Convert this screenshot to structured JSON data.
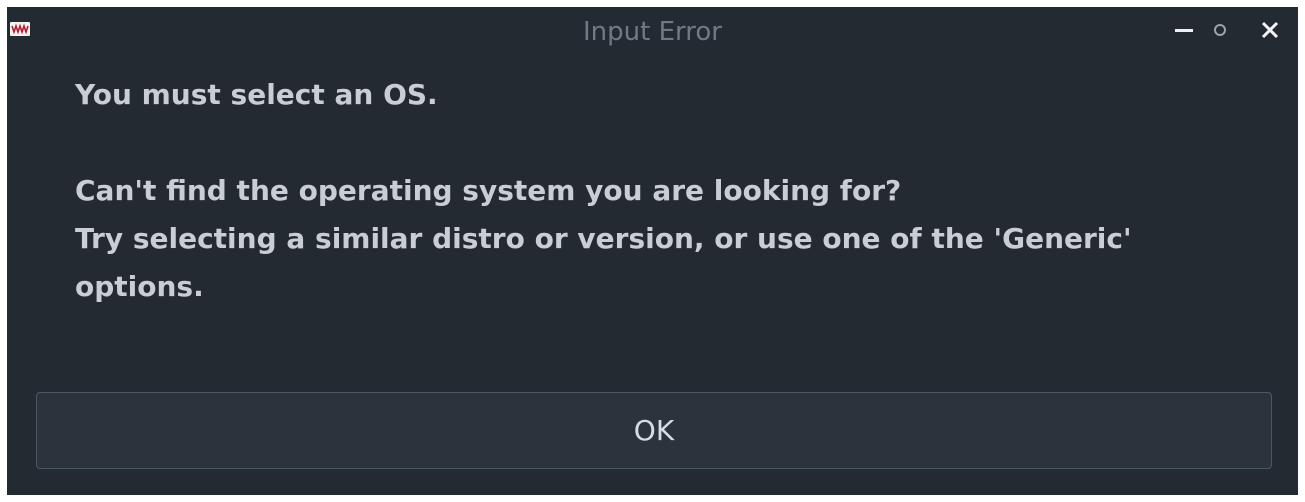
{
  "window": {
    "title": "Input Error",
    "icon": "app-logo-icon",
    "controls": {
      "minimize_icon": "minimize-icon",
      "maximize_icon": "maximize-icon",
      "close_icon": "close-icon"
    }
  },
  "message": {
    "headline": "You must select an OS.",
    "line1": "Can't find the operating system you are looking for?",
    "line2": "Try selecting a similar distro or version, or use one of the 'Generic'",
    "line3": "options."
  },
  "buttons": {
    "ok_label": "OK"
  },
  "colors": {
    "window_bg": "#232a31",
    "text": "#c8ced3",
    "title_text": "#6f7a83",
    "button_border": "#4d5962"
  }
}
